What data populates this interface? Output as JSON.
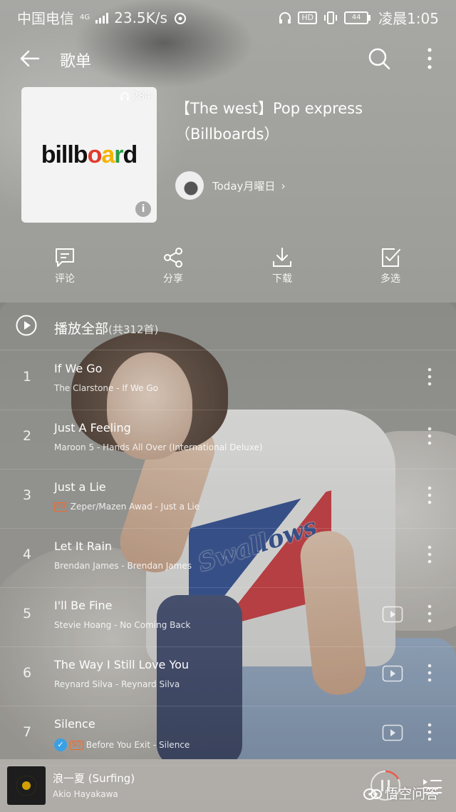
{
  "status_bar": {
    "carrier": "中国电信",
    "network": "4G",
    "speed": "23.5K/s",
    "battery": "44",
    "time": "凌晨1:05"
  },
  "header": {
    "title": "歌单"
  },
  "playlist": {
    "cover_text": "billboard",
    "play_count": "284",
    "info_glyph": "i",
    "title": "【The west】Pop express（Billboards）",
    "creator": "Today月曜日"
  },
  "actions": [
    {
      "label": "评论",
      "icon": "comment-icon"
    },
    {
      "label": "分享",
      "icon": "share-icon"
    },
    {
      "label": "下载",
      "icon": "download-icon"
    },
    {
      "label": "多选",
      "icon": "multiselect-icon"
    }
  ],
  "play_all": {
    "label": "播放全部",
    "count": "(共312首)"
  },
  "songs": [
    {
      "num": "1",
      "title": "If We Go",
      "sub": "The Clarstone - If We Go",
      "sq": false,
      "vip": false,
      "mv": false
    },
    {
      "num": "2",
      "title": "Just A Feeling",
      "sub": "Maroon 5 - Hands All Over (International Deluxe)",
      "sq": false,
      "vip": false,
      "mv": false
    },
    {
      "num": "3",
      "title": "Just a Lie",
      "sub": "Zeper/Mazen Awad - Just a Lie",
      "sq": true,
      "vip": false,
      "mv": false
    },
    {
      "num": "4",
      "title": "Let It Rain",
      "sub": "Brendan James - Brendan James",
      "sq": false,
      "vip": false,
      "mv": false
    },
    {
      "num": "5",
      "title": "I'll Be Fine",
      "sub": "Stevie Hoang - No Coming Back",
      "sq": false,
      "vip": false,
      "mv": true
    },
    {
      "num": "6",
      "title": "The Way I Still Love You",
      "sub": "Reynard Silva - Reynard Silva",
      "sq": false,
      "vip": false,
      "mv": true
    },
    {
      "num": "7",
      "title": "Silence",
      "sub": "Before You Exit - Silence",
      "sq": true,
      "vip": true,
      "mv": true
    }
  ],
  "sq_label": "SQ",
  "now_playing": {
    "title": "浪一夏 (Surfing)",
    "artist": "Akio Hayakawa"
  },
  "watermark": "悟空问答"
}
